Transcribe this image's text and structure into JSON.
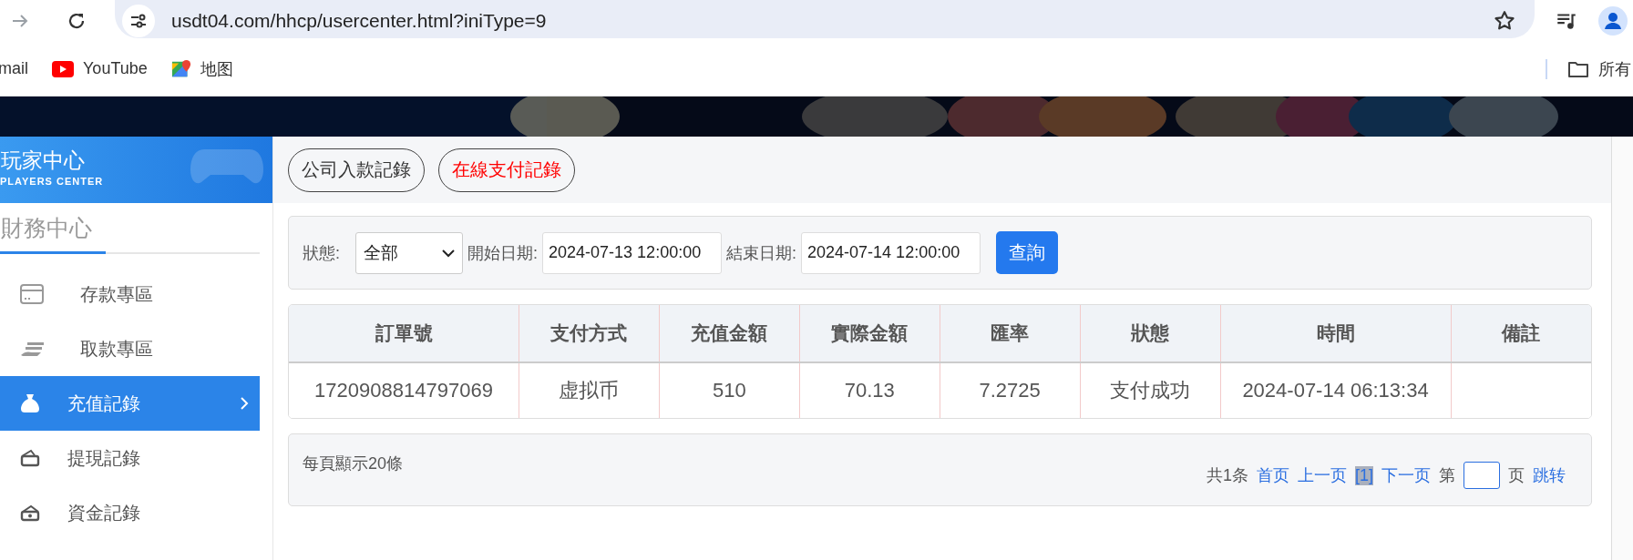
{
  "browser": {
    "url": "usdt04.com/hhcp/usercenter.html?iniType=9",
    "bookmarks": [
      {
        "label": "mail"
      },
      {
        "label": "YouTube"
      },
      {
        "label": "地图"
      }
    ],
    "all_bookmarks": "所有"
  },
  "sidebar": {
    "title": "玩家中心",
    "subtitle": "PLAYERS CENTER",
    "section": "財務中心",
    "items": [
      {
        "label": "存款專區",
        "selected": false
      },
      {
        "label": "取款專區",
        "selected": false
      },
      {
        "label": "充值記錄",
        "selected": true
      },
      {
        "label": "提現記錄",
        "selected": false
      },
      {
        "label": "資金記錄",
        "selected": false
      }
    ]
  },
  "tabs": [
    {
      "label": "公司入款記錄",
      "selected": false
    },
    {
      "label": "在線支付記錄",
      "selected": true
    }
  ],
  "filter": {
    "status_label": "狀態:",
    "status_value": "全部",
    "start_label": "開始日期:",
    "start_value": "2024-07-13 12:00:00",
    "end_label": "結束日期:",
    "end_value": "2024-07-14 12:00:00",
    "query_button": "查詢"
  },
  "table": {
    "columns": [
      "訂單號",
      "支付方式",
      "充值金額",
      "實際金額",
      "匯率",
      "狀態",
      "時間",
      "備註"
    ],
    "rows": [
      [
        "1720908814797069",
        "虚拟币",
        "510",
        "70.13",
        "7.2725",
        "支付成功",
        "2024-07-14 06:13:34",
        ""
      ]
    ]
  },
  "pager": {
    "per_page": "每頁顯示20條",
    "total": "共1条",
    "first": "首页",
    "prev": "上一页",
    "current": "[1]",
    "next": "下一页",
    "page_prefix": "第",
    "page_suffix": "页",
    "jump": "跳转"
  }
}
